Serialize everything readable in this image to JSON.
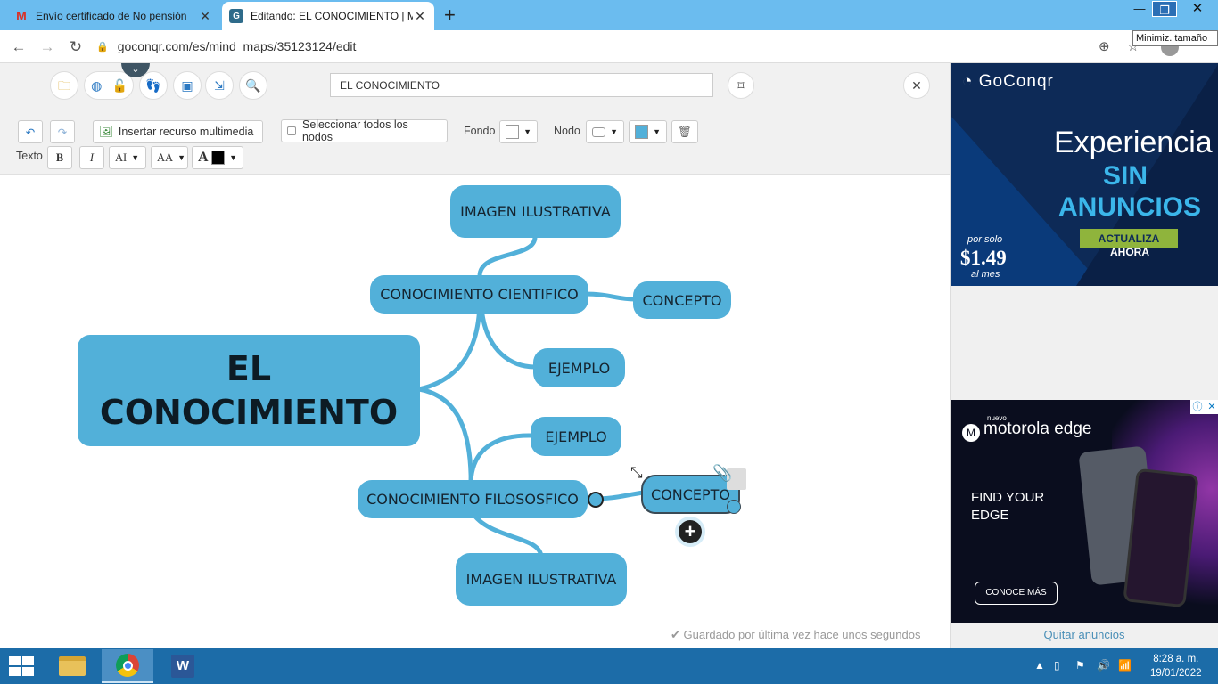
{
  "browser": {
    "tabs": [
      {
        "title": "Envío certificado de No pensión",
        "icon": "gmail-icon"
      },
      {
        "title": "Editando: EL CONOCIMIENTO | M",
        "icon": "goconqr-icon"
      }
    ],
    "new_tab": "+",
    "tooltip": "Minimiz. tamaño",
    "url": "goconqr.com/es/mind_maps/35123124/edit"
  },
  "editor": {
    "map_title": "EL CONOCIMIENTO",
    "toolbar": {
      "insert_media": "Insertar recurso multimedia",
      "select_all": "Seleccionar todos los nodos",
      "background_label": "Fondo",
      "node_label": "Nodo",
      "text_label": "Texto",
      "bold": "B",
      "italic": "I",
      "font_size": "AI",
      "font_case": "AA",
      "font_color_letter": "A",
      "node_color": "#52b0d9",
      "background_color": "#ffffff",
      "font_color": "#000000"
    },
    "nodes": {
      "root": "EL CONOCIMIENTO",
      "cientifico": "CONOCIMIENTO CIENTIFICO",
      "filosofico": "CONOCIMIENTO FILOSOSFICO",
      "img_top": "IMAGEN ILUSTRATIVA",
      "concepto_top": "CONCEPTO",
      "ejemplo_top": "EJEMPLO",
      "ejemplo_bottom": "EJEMPLO",
      "concepto_bottom": "CONCEPTO",
      "img_bottom": "IMAGEN ILUSTRATIVA"
    },
    "save_status": "Guardado por última vez hace unos segundos"
  },
  "ads": {
    "ad1": {
      "brand": "GoConqr",
      "line1": "Experiencia",
      "line2": "SIN",
      "line3": "ANUNCIOS",
      "cta1": "ACTUALIZA",
      "cta2": "AHORA",
      "price_pre": "por solo",
      "price": "$1.49",
      "price_post": "al mes"
    },
    "ad2": {
      "tiny": "nuevo",
      "brand": "motorola edge",
      "headline1": "FIND YOUR",
      "headline2": "EDGE",
      "cta": "CONOCE MÁS"
    },
    "remove_ads": "Quitar anuncios"
  },
  "taskbar": {
    "time": "8:28 a. m.",
    "date": "19/01/2022"
  }
}
